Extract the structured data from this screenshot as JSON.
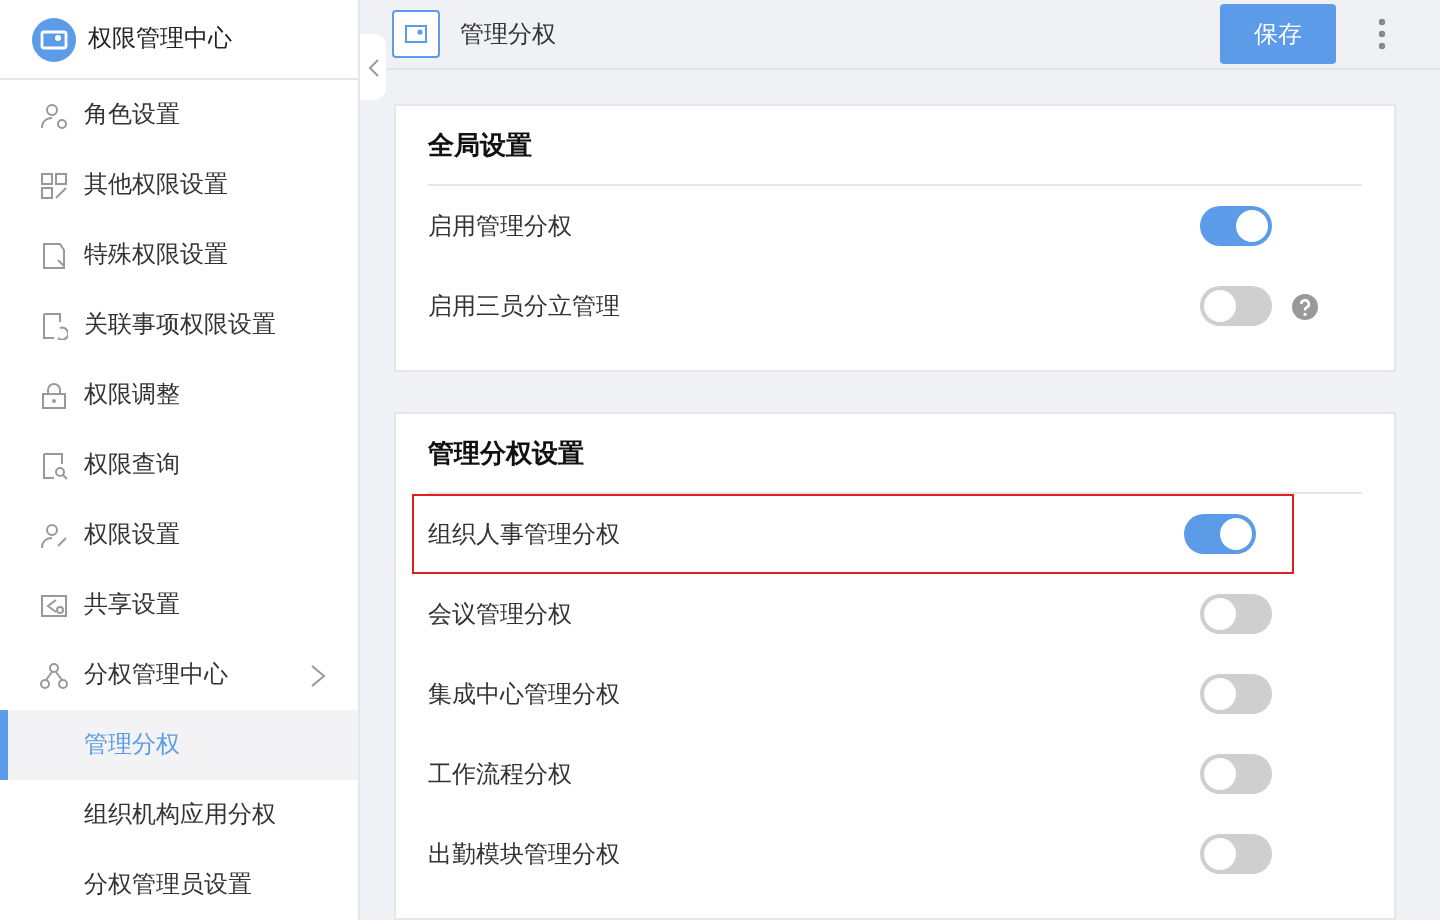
{
  "sidebar": {
    "title": "权限管理中心",
    "items": [
      {
        "label": "角色设置",
        "selected": false
      },
      {
        "label": "其他权限设置",
        "selected": false
      },
      {
        "label": "特殊权限设置",
        "selected": false
      },
      {
        "label": "关联事项权限设置",
        "selected": false
      },
      {
        "label": "权限调整",
        "selected": false
      },
      {
        "label": "权限查询",
        "selected": false
      },
      {
        "label": "权限设置",
        "selected": false
      },
      {
        "label": "共享设置",
        "selected": false
      },
      {
        "label": "分权管理中心",
        "selected": false,
        "expanded": true,
        "children": [
          {
            "label": "管理分权",
            "selected": true
          },
          {
            "label": "组织机构应用分权",
            "selected": false
          },
          {
            "label": "分权管理员设置",
            "selected": false
          }
        ]
      }
    ]
  },
  "header": {
    "title": "管理分权",
    "save_button": "保存"
  },
  "sections": [
    {
      "title": "全局设置",
      "rows": [
        {
          "label": "启用管理分权",
          "on": true,
          "help": false,
          "highlighted": false
        },
        {
          "label": "启用三员分立管理",
          "on": false,
          "help": true,
          "highlighted": false
        }
      ]
    },
    {
      "title": "管理分权设置",
      "rows": [
        {
          "label": "组织人事管理分权",
          "on": true,
          "help": false,
          "highlighted": true
        },
        {
          "label": "会议管理分权",
          "on": false,
          "help": false,
          "highlighted": false
        },
        {
          "label": "集成中心管理分权",
          "on": false,
          "help": false,
          "highlighted": false
        },
        {
          "label": "工作流程分权",
          "on": false,
          "help": false,
          "highlighted": false
        },
        {
          "label": "出勤模块管理分权",
          "on": false,
          "help": false,
          "highlighted": false
        }
      ]
    }
  ]
}
